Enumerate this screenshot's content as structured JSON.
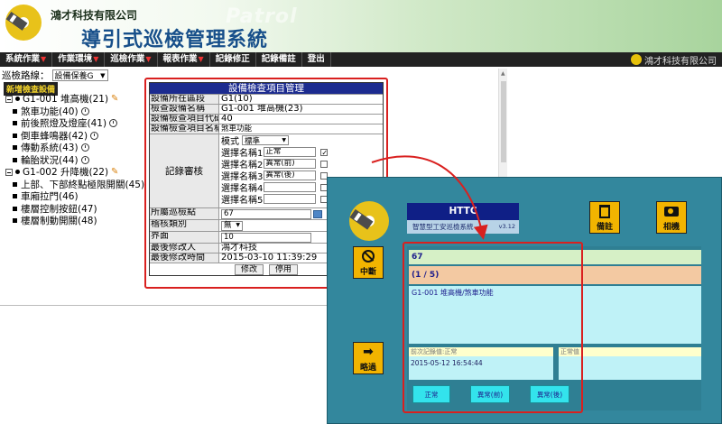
{
  "header": {
    "company": "鴻才科技有限公司",
    "title": "導引式巡檢管理系統",
    "watermark": "Patrol"
  },
  "menubar": {
    "items": [
      {
        "label": "系統作業",
        "has_dropdown": true
      },
      {
        "label": "作業環境",
        "has_dropdown": true
      },
      {
        "label": "巡檢作業",
        "has_dropdown": true
      },
      {
        "label": "報表作業",
        "has_dropdown": true
      },
      {
        "label": "記錄修正",
        "has_dropdown": false
      },
      {
        "label": "記錄備註",
        "has_dropdown": false
      },
      {
        "label": "登出",
        "has_dropdown": false
      }
    ],
    "brand": "鴻才科技有限公司"
  },
  "route": {
    "label": "巡檢路線：",
    "selected": "設備保養G"
  },
  "add_equipment_label": "新增檢查設備",
  "tree": {
    "equipment": [
      {
        "name": "G1-001 堆高機(21)",
        "items": [
          "煞車功能(40)",
          "前後照燈及燈座(41)",
          "倒車蜂鳴器(42)",
          "傳動系統(43)",
          "輪胎狀況(44)"
        ]
      },
      {
        "name": "G1-002 升降機(22)",
        "items": [
          "上部、下部終點極限開關(45)",
          "車廂拉門(46)",
          "樓層控制按鈕(47)",
          "樓層制動開關(48)"
        ]
      }
    ]
  },
  "form": {
    "title": "設備檢查項目管理",
    "rows": [
      {
        "label": "設備所在區段",
        "value": "G1(10)"
      },
      {
        "label": "檢查設備名稱",
        "value": "G1-001 堆高機(23)"
      },
      {
        "label": "設備檢查項目代碼",
        "value": "40"
      },
      {
        "label": "設備檢查項目名稱",
        "value": "煞車功能"
      }
    ],
    "record_label": "記錄審核",
    "mode_label": "模式",
    "mode_value": "標準",
    "options": [
      {
        "label": "選擇名稱1",
        "value": "正常",
        "checked": true
      },
      {
        "label": "選擇名稱2",
        "value": "異常(前)",
        "checked": false
      },
      {
        "label": "選擇名稱3",
        "value": "異常(後)",
        "checked": false
      },
      {
        "label": "選擇名稱4",
        "value": "",
        "checked": false
      },
      {
        "label": "選擇名稱5",
        "value": "",
        "checked": false
      }
    ],
    "checkpoint_label": "所屬巡檢點",
    "checkpoint_value": "67",
    "audit_label": "稽核類別",
    "audit_value": "無",
    "interface_label": "界面",
    "interface_value": "10",
    "modifier_label": "最後修改人",
    "modifier_value": "鴻才科技",
    "modtime_label": "最後修改時間",
    "modtime_value": "2015-03-10 11:39:29",
    "edit_button": "修改",
    "disable_button": "停用"
  },
  "device": {
    "app_name": "HTTC",
    "app_subtitle": "智慧型工安巡檢系統",
    "version": "v3.12",
    "memo_button": "備註",
    "camera_button": "相機",
    "interrupt_button": "中斷",
    "skip_button": "略過",
    "checkpoint": "67",
    "progress": "(1 / 5)",
    "item_path": "G1-001 堆高機/煞車功能",
    "prev_label": "前次記錄值:正常",
    "prev_time": "2015-05-12 16:54:44",
    "normal_value_label": "正常值",
    "option_buttons": [
      "正常",
      "異常(前)",
      "異常(後)"
    ]
  },
  "colors": {
    "form_title_bg": "#1c2b8f",
    "highlight": "#d9201f",
    "device_bg": "#33879d",
    "device_button": "#f2b400"
  }
}
